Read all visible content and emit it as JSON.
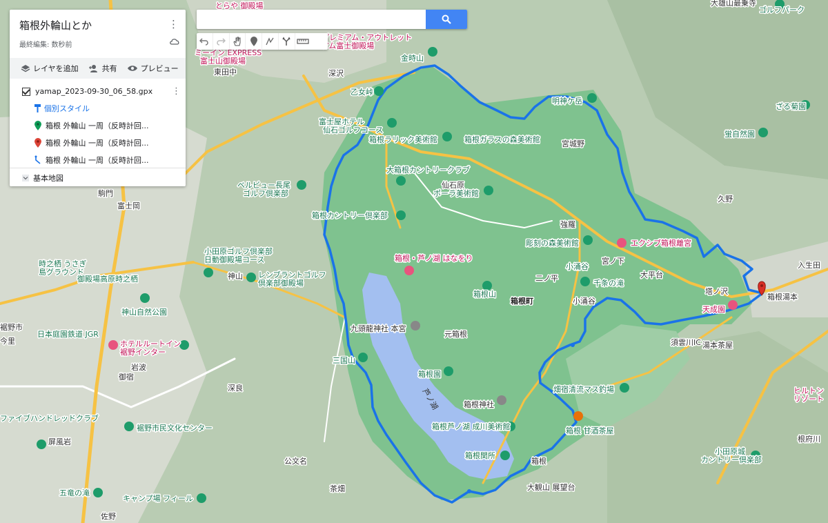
{
  "panel": {
    "title": "箱根外輪山とか",
    "edited": "最終編集: 数秒前",
    "actions": {
      "add_layer": "レイヤを追加",
      "share": "共有",
      "preview": "プレビュー"
    },
    "layer": {
      "name": "yamap_2023-09-30_06_58.gpx",
      "style_link": "個別スタイル",
      "items": [
        {
          "label": "箱根 外輪山 一周（反時計回...",
          "icon": "green-pin-icon"
        },
        {
          "label": "箱根 外輪山 一周（反時計回...",
          "icon": "red-pin-icon"
        },
        {
          "label": "箱根 外輪山 一周（反時計回...",
          "icon": "route-line-icon"
        }
      ]
    },
    "base_map": "基本地図"
  },
  "search": {
    "placeholder": "",
    "value": ""
  },
  "toolbar": [
    "undo-icon",
    "redo-icon",
    "hand-icon",
    "marker-icon",
    "draw-line-icon",
    "directions-icon",
    "ruler-icon"
  ],
  "colors": {
    "route": "#1a73e8",
    "park": "#7fc28f",
    "terrain": "#b9ccb3",
    "road_major": "#f6c244",
    "accent": "#4285f4"
  },
  "map_labels": {
    "kintokizan": "金時山",
    "myojingatake": "明神ケ岳",
    "otomezaka": "乙女峠",
    "fujiya_golf": "富士屋ホテル",
    "sengoku_golf": "仙石ゴルフコース",
    "lalique": "箱根ラリック美術館",
    "garasu": "箱根ガラスの森美術館",
    "miyagino": "宮城野",
    "cc_large": "大箱根カントリークラブ",
    "sengokuhara": "仙石原",
    "pola": "ポーラ美術館",
    "bellview": "ベルビュー長尾",
    "bellview2": "ゴルフ倶楽部",
    "hakone_cc": "箱根カントリー倶楽部",
    "gora": "強羅",
    "chokoku": "彫刻の森美術館",
    "excive": "エクシブ箱根離宮",
    "kowakidani": "小涌谷",
    "miyanoshita": "宮ノ下",
    "ohiradai": "大平台",
    "tonosawa": "塔ノ沢",
    "yumoto": "箱根湯本",
    "tenseien": "天成園",
    "ashinoko_hanaori": "箱根・芦ノ湖 はなをり",
    "hakoneyama": "箱根山",
    "hakonemachi": "箱根町",
    "ninotaira": "二ノ平",
    "senjo": "千条の滝",
    "kowakien": "小涌谷",
    "kuzuryu": "九頭龍神社 本宮",
    "motohakone": "元箱根",
    "mikuniyama": "三国山",
    "ashinoko": "箱根園",
    "lake": "芦ノ湖",
    "hakone_jinja": "箱根神社",
    "narikawa": "箱根芦ノ湖 成川美術館",
    "sekisho": "箱根関所",
    "amazake": "箱根 甘酒茶屋",
    "hatajuku": "畑宿清流マス釣場",
    "taikanzan": "大観山 展望台",
    "hakone_lbl": "箱根",
    "ochaya": "湯本茶屋",
    "sukumo": "須雲川IC",
    "kuno": "久野",
    "iriuda": "入生田",
    "zaruku": "ざる菊園",
    "hotaru": "蛍自然園",
    "odawara_golf1": "小田原ゴルフ倶楽部",
    "odawara_golf2": "日動御殿場コース",
    "rembrandt1": "レンブラントゴルフ",
    "rembrandt2": "倶楽部御殿場",
    "kamiyama": "神山",
    "kamiyama_park": "神山自然公園",
    "jigyo": "時之栖 うさぎ",
    "jigyo2": "島グラウンド",
    "gotemba_kogen": "御殿場高原時之栖",
    "nihon_teien": "日本庭園鉄道 JGR",
    "hotel_route1": "ホテルルートイン",
    "hotel_route2": "裾野インター",
    "iwanami": "岩波",
    "miso": "御宿",
    "fukara": "深良",
    "five_hundred": "ファイブハンドレッドクラブ",
    "susono_center": "裾野市民文化センター",
    "byofu": "屏風岩",
    "godaki": "五竜の滝",
    "camp": "キャンプ場 フィール",
    "sano": "佐野",
    "kobun": "公文名",
    "chaya": "茶畑",
    "ohira": "大雄山最乗寺",
    "golf_park": "ゴルフパーク",
    "odawara_cc1": "小田原城",
    "odawara_cc2": "カントリー倶楽部",
    "hilton1": "ヒルトン",
    "hilton2": "リゾート",
    "negoya": "根府川",
    "fujioka": "富士岡",
    "komakado": "駒門",
    "kamikaido": "東田中",
    "fukazawa": "深沢",
    "susonoshi": "裾野市",
    "konno": "今里",
    "premium1": "プレミアム・アウトレット",
    "premium2": "アム富士御殿場",
    "tomin": "ミーイン EXPRESS",
    "tomin2": "富士山御殿場",
    "gotemba_top": "とらや 御殿場"
  }
}
